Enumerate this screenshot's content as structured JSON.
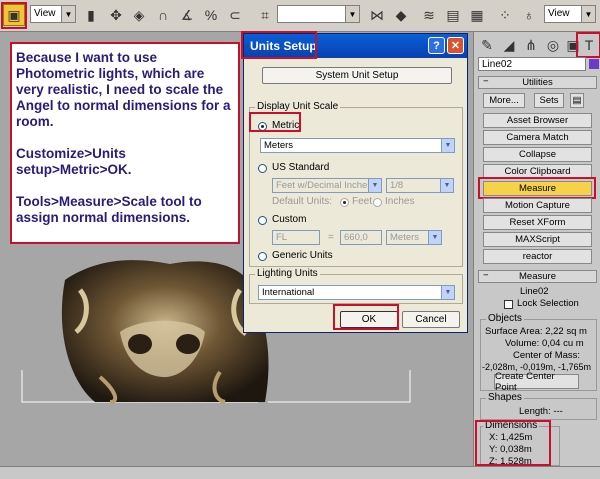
{
  "toolbar": {
    "view_select_1": "View",
    "view_select_2": "View"
  },
  "note": {
    "para1": "Because I want to use Photometric lights, which are very realistic, I need to scale the Angel to normal dimensions for a room.",
    "para2": "Customize>Units setup>Metric>OK.",
    "para3": "Tools>Measure>Scale tool to assign normal dimensions."
  },
  "dialog": {
    "title": "Units Setup",
    "help_btn": "?",
    "close_btn": "✕",
    "system_unit_setup": "System Unit Setup",
    "display_unit_scale": "Display Unit Scale",
    "metric_label": "Metric",
    "metric_value": "Meters",
    "us_standard_label": "US Standard",
    "us_value": "Feet w/Decimal Inches",
    "us_fraction": "1/8",
    "default_units_label": "Default Units:",
    "feet_label": "Feet",
    "inches_label": "Inches",
    "custom_label": "Custom",
    "custom_name": "FL",
    "equals": "=",
    "custom_value": "660,0",
    "custom_unit": "Meters",
    "generic_units_label": "Generic Units",
    "lighting_units": "Lighting Units",
    "lighting_value": "International",
    "ok": "OK",
    "cancel": "Cancel"
  },
  "panel": {
    "object_name": "Line02",
    "utilities_header": "Utilities",
    "more": "More...",
    "sets": "Sets",
    "buttons": [
      "Asset Browser",
      "Camera Match",
      "Collapse",
      "Color Clipboard",
      "Measure",
      "Motion Capture",
      "Reset XForm",
      "MAXScript",
      "reactor"
    ],
    "measure_header": "Measure",
    "measure_object": "Line02",
    "lock_selection": "Lock Selection",
    "objects_label": "Objects",
    "surface_area": "Surface Area: 2,22 sq m",
    "volume": "Volume: 0,04 cu m",
    "center_of_mass_label": "Center of Mass:",
    "center_of_mass": "-2,028m, -0,019m, -1,765m",
    "create_center_point": "Create Center Point",
    "shapes_label": "Shapes",
    "length": "Length: ---",
    "dimensions_label": "Dimensions",
    "dim_x": "X:  1,425m",
    "dim_y": "Y:  0,038m",
    "dim_z": "Z:  1,528m"
  },
  "colors": {
    "highlight": "#c8102e",
    "note_text": "#2b1a7a",
    "titlebar": "#0a5fd8",
    "measure_active": "#f6d24a"
  }
}
